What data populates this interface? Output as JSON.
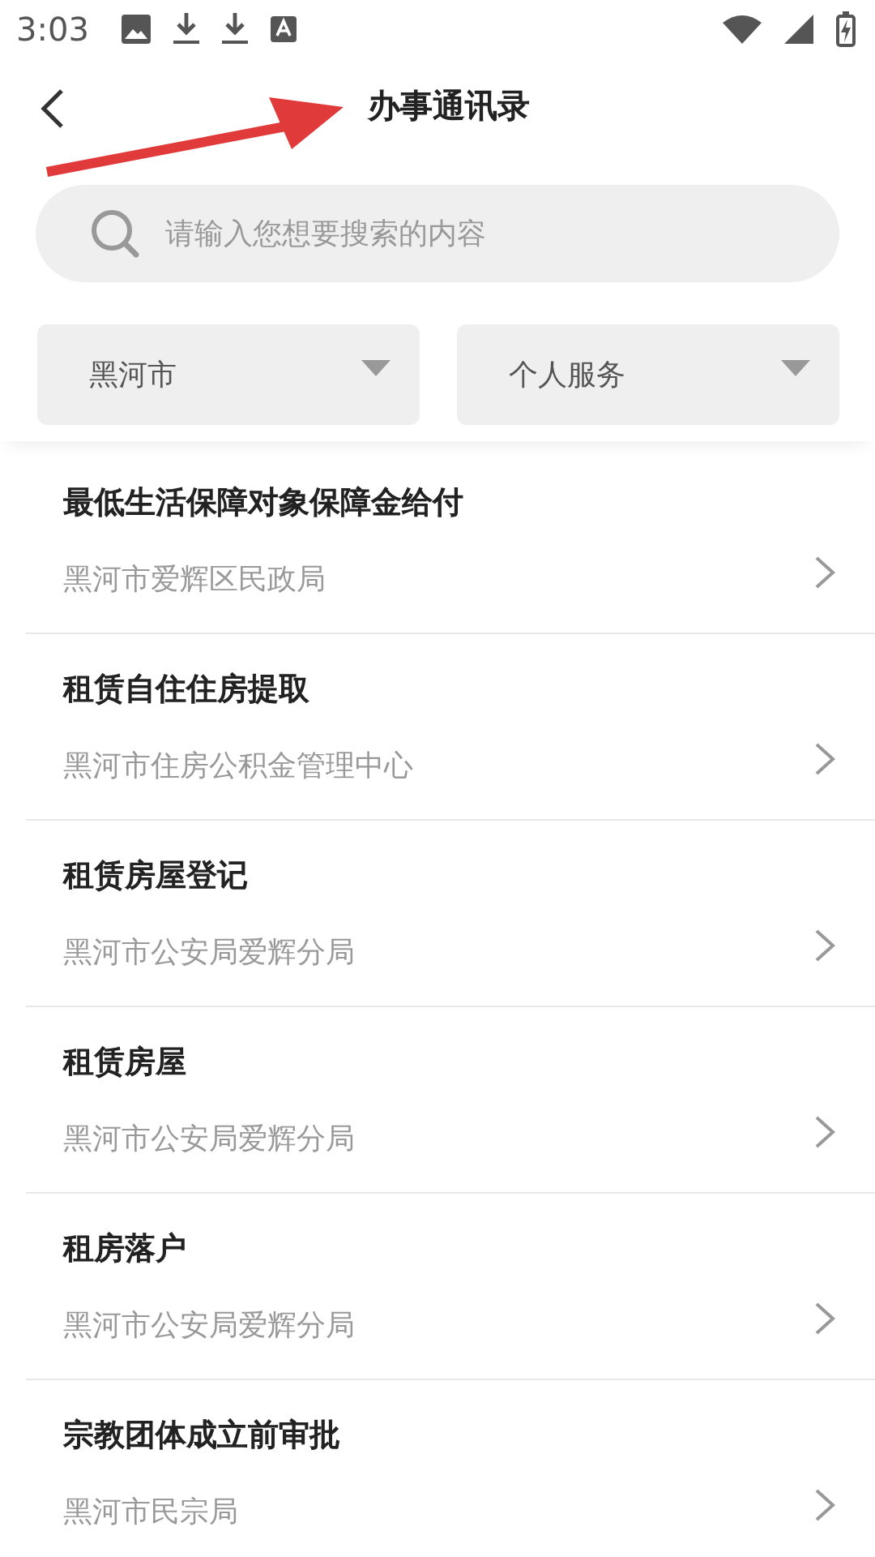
{
  "status_bar": {
    "time": "3:03"
  },
  "header": {
    "title": "办事通讯录"
  },
  "search": {
    "placeholder": "请输入您想要搜索的内容"
  },
  "filters": [
    {
      "label": "黑河市"
    },
    {
      "label": "个人服务"
    }
  ],
  "items": [
    {
      "title": "最低生活保障对象保障金给付",
      "department": "黑河市爱辉区民政局"
    },
    {
      "title": "租赁自住住房提取",
      "department": "黑河市住房公积金管理中心"
    },
    {
      "title": "租赁房屋登记",
      "department": "黑河市公安局爱辉分局"
    },
    {
      "title": "租赁房屋",
      "department": "黑河市公安局爱辉分局"
    },
    {
      "title": "租房落户",
      "department": "黑河市公安局爱辉分局"
    },
    {
      "title": "宗教团体成立前审批",
      "department": "黑河市民宗局"
    }
  ]
}
